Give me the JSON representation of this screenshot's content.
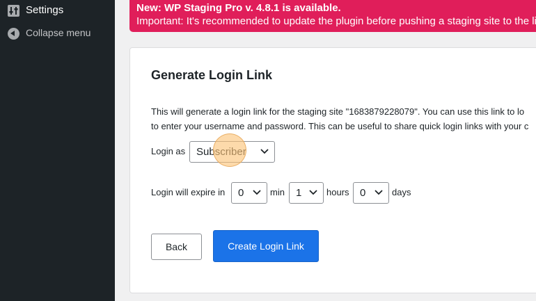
{
  "sidebar": {
    "settings_label": "Settings",
    "settings_icon": "settings-sliders-icon",
    "collapse_label": "Collapse menu",
    "collapse_icon": "collapse-arrow-icon"
  },
  "notice": {
    "title": "New: WP Staging Pro v. 4.8.1 is available.",
    "text": "Important: It's recommended to update the plugin before pushing a staging site to the live",
    "color": "#e01e5a"
  },
  "card": {
    "title": "Generate Login Link",
    "description_line1": "This will generate a login link for the staging site \"1683879228079\". You can use this link to lo",
    "description_line2": "to enter your username and password. This can be useful to share quick login links with your c"
  },
  "login_as": {
    "label": "Login as",
    "selected": "Subscriber"
  },
  "expiry": {
    "prefix": "Login will expire in",
    "minutes_value": "0",
    "minutes_unit": "min",
    "hours_value": "1",
    "hours_unit": "hours",
    "days_value": "0",
    "days_unit": "days"
  },
  "buttons": {
    "back": "Back",
    "create": "Create Login Link",
    "primary_color": "#1b73e8"
  }
}
